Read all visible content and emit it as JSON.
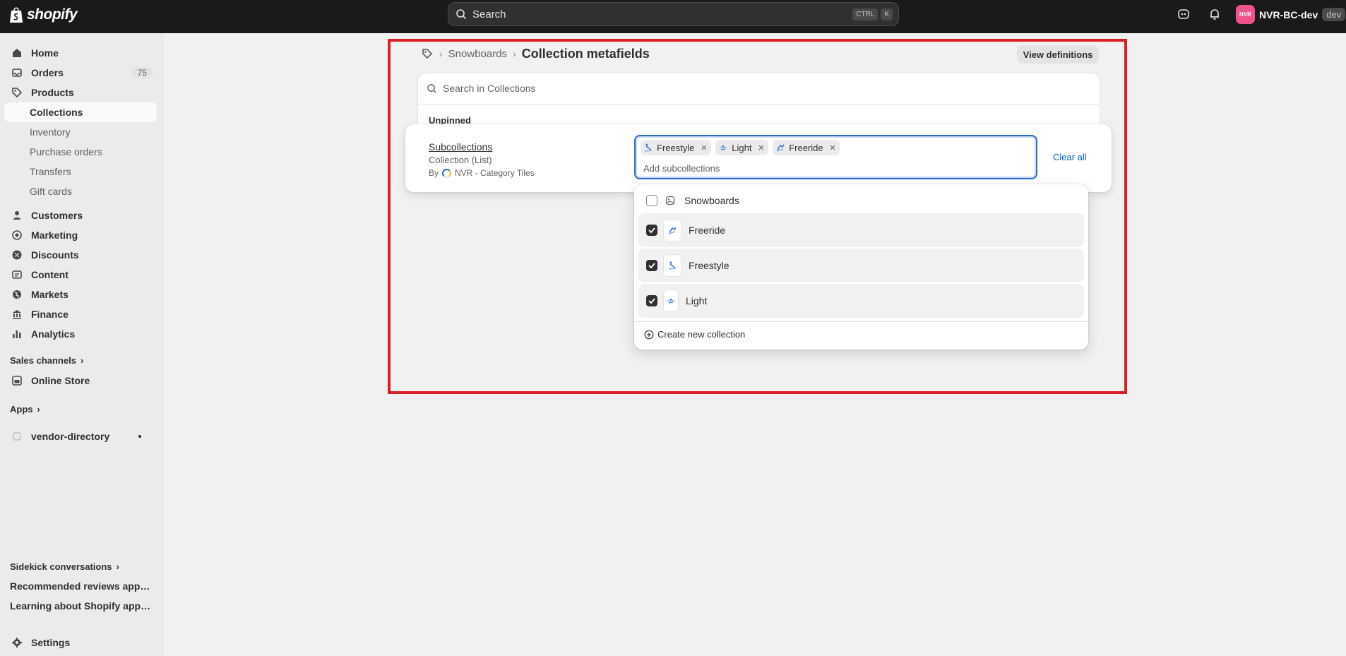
{
  "topbar": {
    "logo_text": "shopify",
    "search_placeholder": "Search",
    "shortcut_ctrl": "CTRL",
    "shortcut_key": "K",
    "avatar_initials": "NVR",
    "store_name": "NVR-BC-dev",
    "store_badge": "dev",
    "avatar_color": "#f2528c"
  },
  "sidebar": {
    "items": [
      {
        "label": "Home",
        "icon": "home-icon"
      },
      {
        "label": "Orders",
        "icon": "inbox-icon",
        "badge": "75"
      },
      {
        "label": "Products",
        "icon": "tag-icon"
      },
      {
        "label": "Collections"
      },
      {
        "label": "Inventory"
      },
      {
        "label": "Purchase orders"
      },
      {
        "label": "Transfers"
      },
      {
        "label": "Gift cards"
      },
      {
        "label": "Customers",
        "icon": "person-icon"
      },
      {
        "label": "Marketing",
        "icon": "target-icon"
      },
      {
        "label": "Discounts",
        "icon": "discount-icon"
      },
      {
        "label": "Content",
        "icon": "content-icon"
      },
      {
        "label": "Markets",
        "icon": "globe-icon"
      },
      {
        "label": "Finance",
        "icon": "bank-icon"
      },
      {
        "label": "Analytics",
        "icon": "chart-icon"
      }
    ],
    "sales_channels_label": "Sales channels",
    "online_store_label": "Online Store",
    "apps_label": "Apps",
    "vendor_directory_label": "vendor-directory",
    "sidekick_label": "Sidekick conversations",
    "conversation_1": "Recommended reviews apps f...",
    "conversation_2": "Learning about Shopify apps a...",
    "settings_label": "Settings"
  },
  "main": {
    "breadcrumb_parent": "Snowboards",
    "page_title": "Collection metafields",
    "view_definitions_label": "View definitions",
    "search_placeholder": "Search in Collections",
    "section_label": "Unpinned",
    "metafield": {
      "name": "Subcollections",
      "type": "Collection (List)",
      "by_prefix": "By",
      "by_app": "NVR - Category Tiles"
    },
    "tags": [
      "Freestyle",
      "Light",
      "Freeride"
    ],
    "input_placeholder": "Add subcollections",
    "clear_all_label": "Clear all",
    "dropdown": {
      "options": [
        {
          "label": "Snowboards",
          "checked": false
        },
        {
          "label": "Freeride",
          "checked": true
        },
        {
          "label": "Freestyle",
          "checked": true
        },
        {
          "label": "Light",
          "checked": true
        }
      ],
      "create_label": "Create new collection"
    },
    "accent_color": "#2c6ecb",
    "highlight_color": "#d92027"
  }
}
